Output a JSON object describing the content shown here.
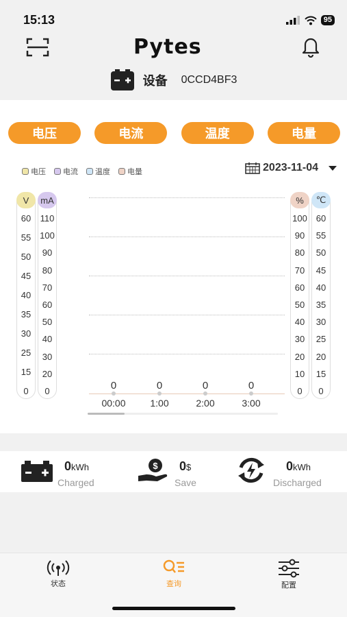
{
  "status_bar": {
    "time": "15:13",
    "battery": "95"
  },
  "header": {
    "logo": "Pytes"
  },
  "device": {
    "label": "设备",
    "id": "0CCD4BF3"
  },
  "tabs": [
    {
      "label": "电压"
    },
    {
      "label": "电流"
    },
    {
      "label": "温度"
    },
    {
      "label": "电量"
    }
  ],
  "legend": [
    {
      "label": "电压",
      "color": "#f0e6a8"
    },
    {
      "label": "电流",
      "color": "#d6c8ee"
    },
    {
      "label": "温度",
      "color": "#cfe6f7"
    },
    {
      "label": "电量",
      "color": "#efd3c6"
    }
  ],
  "date": "2023-11-04",
  "chart_data": {
    "type": "bar",
    "categories": [
      "00:00",
      "1:00",
      "2:00",
      "3:00"
    ],
    "series": [
      {
        "values": [
          0,
          0,
          0,
          0
        ]
      }
    ],
    "axes": {
      "voltage": {
        "unit": "V",
        "ticks": [
          "60",
          "55",
          "50",
          "45",
          "40",
          "35",
          "30",
          "25",
          "15",
          "0"
        ],
        "color": "#f0e6a8"
      },
      "current": {
        "unit": "mA",
        "ticks": [
          "110",
          "100",
          "90",
          "80",
          "70",
          "60",
          "50",
          "40",
          "30",
          "20",
          "0"
        ],
        "color": "#d6c8ee"
      },
      "capacity": {
        "unit": "%",
        "ticks": [
          "100",
          "90",
          "80",
          "70",
          "60",
          "50",
          "40",
          "30",
          "20",
          "10",
          "0"
        ],
        "color": "#efd3c6"
      },
      "temperature": {
        "unit": "℃",
        "ticks": [
          "60",
          "55",
          "50",
          "45",
          "40",
          "35",
          "30",
          "25",
          "20",
          "15",
          "0"
        ],
        "color": "#cfe6f7"
      }
    }
  },
  "summary": {
    "charged": {
      "value": "0",
      "unit": "kWh",
      "label": "Charged"
    },
    "save": {
      "value": "0",
      "unit": "$",
      "label": "Save"
    },
    "discharged": {
      "value": "0",
      "unit": "kWh",
      "label": "Discharged"
    }
  },
  "nav": [
    {
      "label": "状态"
    },
    {
      "label": "查询"
    },
    {
      "label": "配置"
    }
  ],
  "colors": {
    "accent": "#f59a29"
  }
}
